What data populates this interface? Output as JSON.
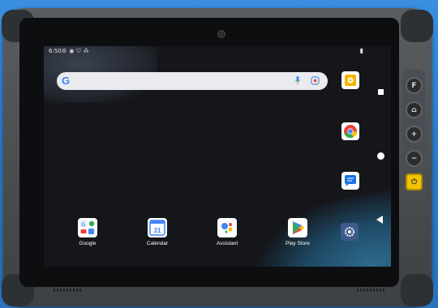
{
  "status": {
    "time": "6:50",
    "icons": [
      "gear-icon",
      "android-icon",
      "shield-icon",
      "notification-icon"
    ],
    "battery_icon": "battery-icon"
  },
  "search": {
    "logo": "G",
    "icons": [
      "mic-icon",
      "lens-icon"
    ]
  },
  "apps": [
    {
      "label": "Google",
      "icon": "google-folder-icon"
    },
    {
      "label": "Calendar",
      "icon": "calendar-icon"
    },
    {
      "label": "Assistant",
      "icon": "assistant-icon"
    },
    {
      "label": "Play Store",
      "icon": "play-store-icon"
    }
  ],
  "right_apps": [
    "settings-app-icon",
    "chrome-icon",
    "messages-icon",
    "settings-gear-icon"
  ],
  "nav": [
    "recents-button",
    "home-button",
    "back-button"
  ],
  "side_buttons": [
    "F",
    "⌂",
    "+",
    "−",
    "⏻"
  ],
  "colors": {
    "accent_yellow": "#f2c300",
    "frame": "#4a4d51"
  }
}
